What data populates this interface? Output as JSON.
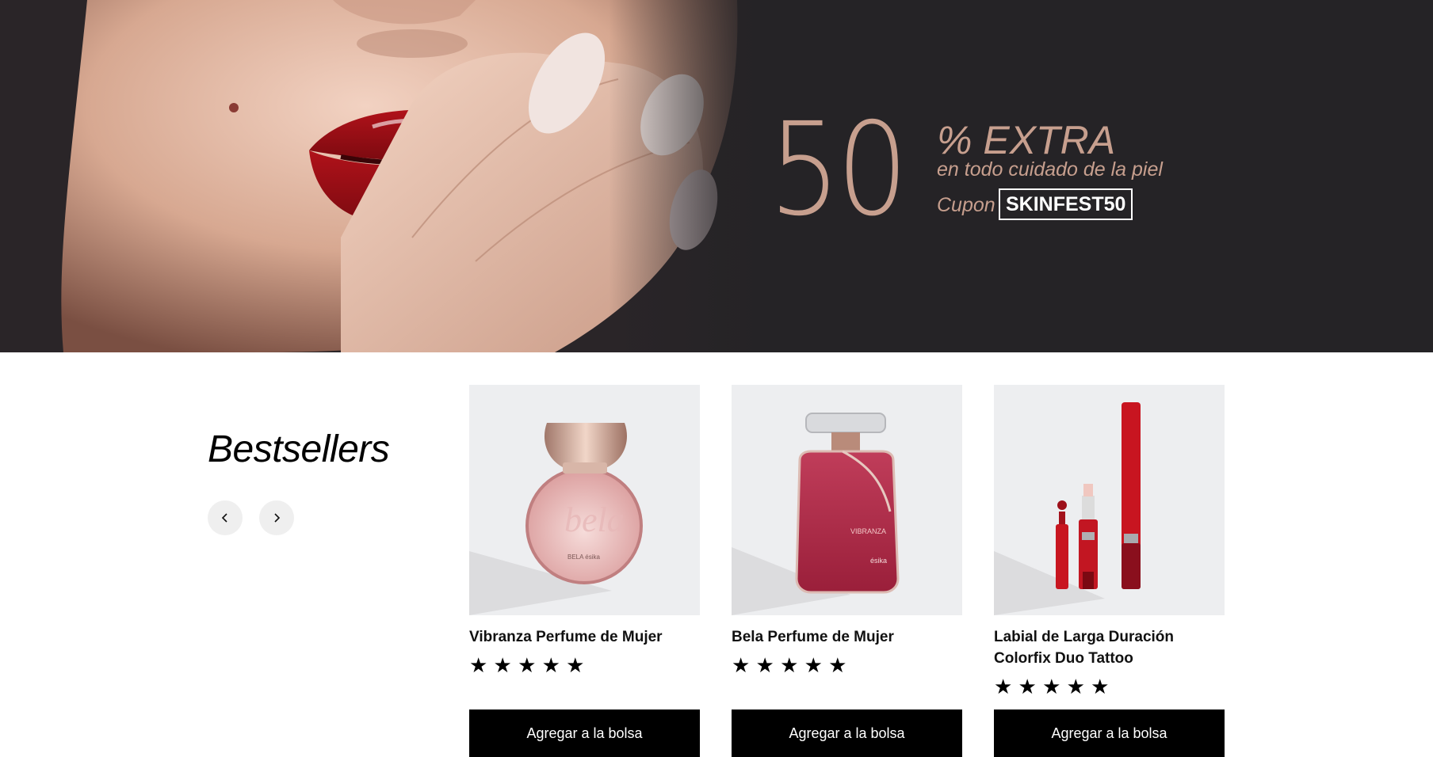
{
  "hero": {
    "promo_number": "50",
    "promo_extra": "% EXTRA",
    "promo_subtitle": "en todo cuidado de la piel",
    "cupon_label": "Cupon",
    "cupon_code": "SKINFEST50",
    "colors": {
      "background": "#252326",
      "accent": "#c79f8e"
    }
  },
  "bestsellers": {
    "title": "Bestsellers",
    "prev_icon": "chevron-left-icon",
    "next_icon": "chevron-right-icon",
    "products": [
      {
        "name": "Vibranza Perfume de Mujer",
        "rating": 5,
        "stars": "★ ★ ★ ★ ★",
        "button": "Agregar a la bolsa",
        "bottle_text": "BELA ésika"
      },
      {
        "name": "Bela Perfume de Mujer",
        "rating": 5,
        "stars": "★ ★ ★ ★ ★",
        "button": "Agregar a la bolsa",
        "bottle_text": "VIBRANZA",
        "brand": "ésika"
      },
      {
        "name": "Labial de Larga Duración Colorfix Duo Tattoo",
        "rating": 5,
        "stars": "★ ★ ★ ★ ★",
        "button": "Agregar a la bolsa"
      }
    ]
  }
}
